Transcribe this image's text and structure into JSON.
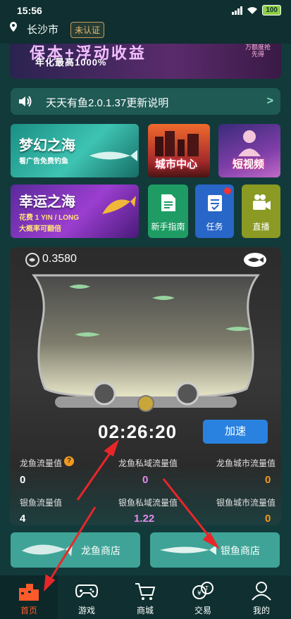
{
  "status_bar": {
    "time": "15:56",
    "battery": "100"
  },
  "location": {
    "city": "长沙市",
    "cert_status": "未认证"
  },
  "promo": {
    "title": "保本+浮动收益",
    "subtitle": "年化最高1000%",
    "side_text": "万额度抢先得"
  },
  "announcement": {
    "text": "天天有鱼2.0.1.37更新说明",
    "arrow": ">"
  },
  "tiles": {
    "dream_sea": {
      "title": "梦幻之海",
      "subtitle": "看广告免费钓鱼"
    },
    "city_center": {
      "title": "城市中心"
    },
    "short_video": {
      "title": "短视频"
    },
    "lucky_sea": {
      "title": "幸运之海",
      "line1": "花费 1 YIN / LONG",
      "line2": "大概率可翻倍"
    },
    "guide": {
      "label": "新手指南"
    },
    "task": {
      "label": "任务"
    },
    "live": {
      "label": "直播"
    }
  },
  "aquarium": {
    "balance": "0.3580",
    "timer": "02:26:20",
    "speed_button": "加速",
    "stats": {
      "dragon_flow_label": "龙鱼流量值",
      "dragon_flow_value": "0",
      "dragon_private_label": "龙鱼私域流量值",
      "dragon_private_value": "0",
      "dragon_city_label": "龙鱼城市流量值",
      "dragon_city_value": "0",
      "silver_flow_label": "银鱼流量值",
      "silver_flow_value": "4",
      "silver_private_label": "银鱼私域流量值",
      "silver_private_value": "1.22",
      "silver_city_label": "银鱼城市流量值",
      "silver_city_value": "0",
      "help": "?"
    }
  },
  "shops": {
    "dragon": "龙鱼商店",
    "silver": "银鱼商店"
  },
  "nav": [
    {
      "label": "首页",
      "icon": "home-icon"
    },
    {
      "label": "游戏",
      "icon": "gamepad-icon"
    },
    {
      "label": "商城",
      "icon": "cart-icon"
    },
    {
      "label": "交易",
      "icon": "exchange-icon"
    },
    {
      "label": "我的",
      "icon": "user-icon"
    }
  ],
  "colors": {
    "accent_orange": "#f19a1f",
    "accent_pink": "#e28cf0",
    "nav_active": "#ff5a2a",
    "speed_button": "#2a82e0"
  }
}
